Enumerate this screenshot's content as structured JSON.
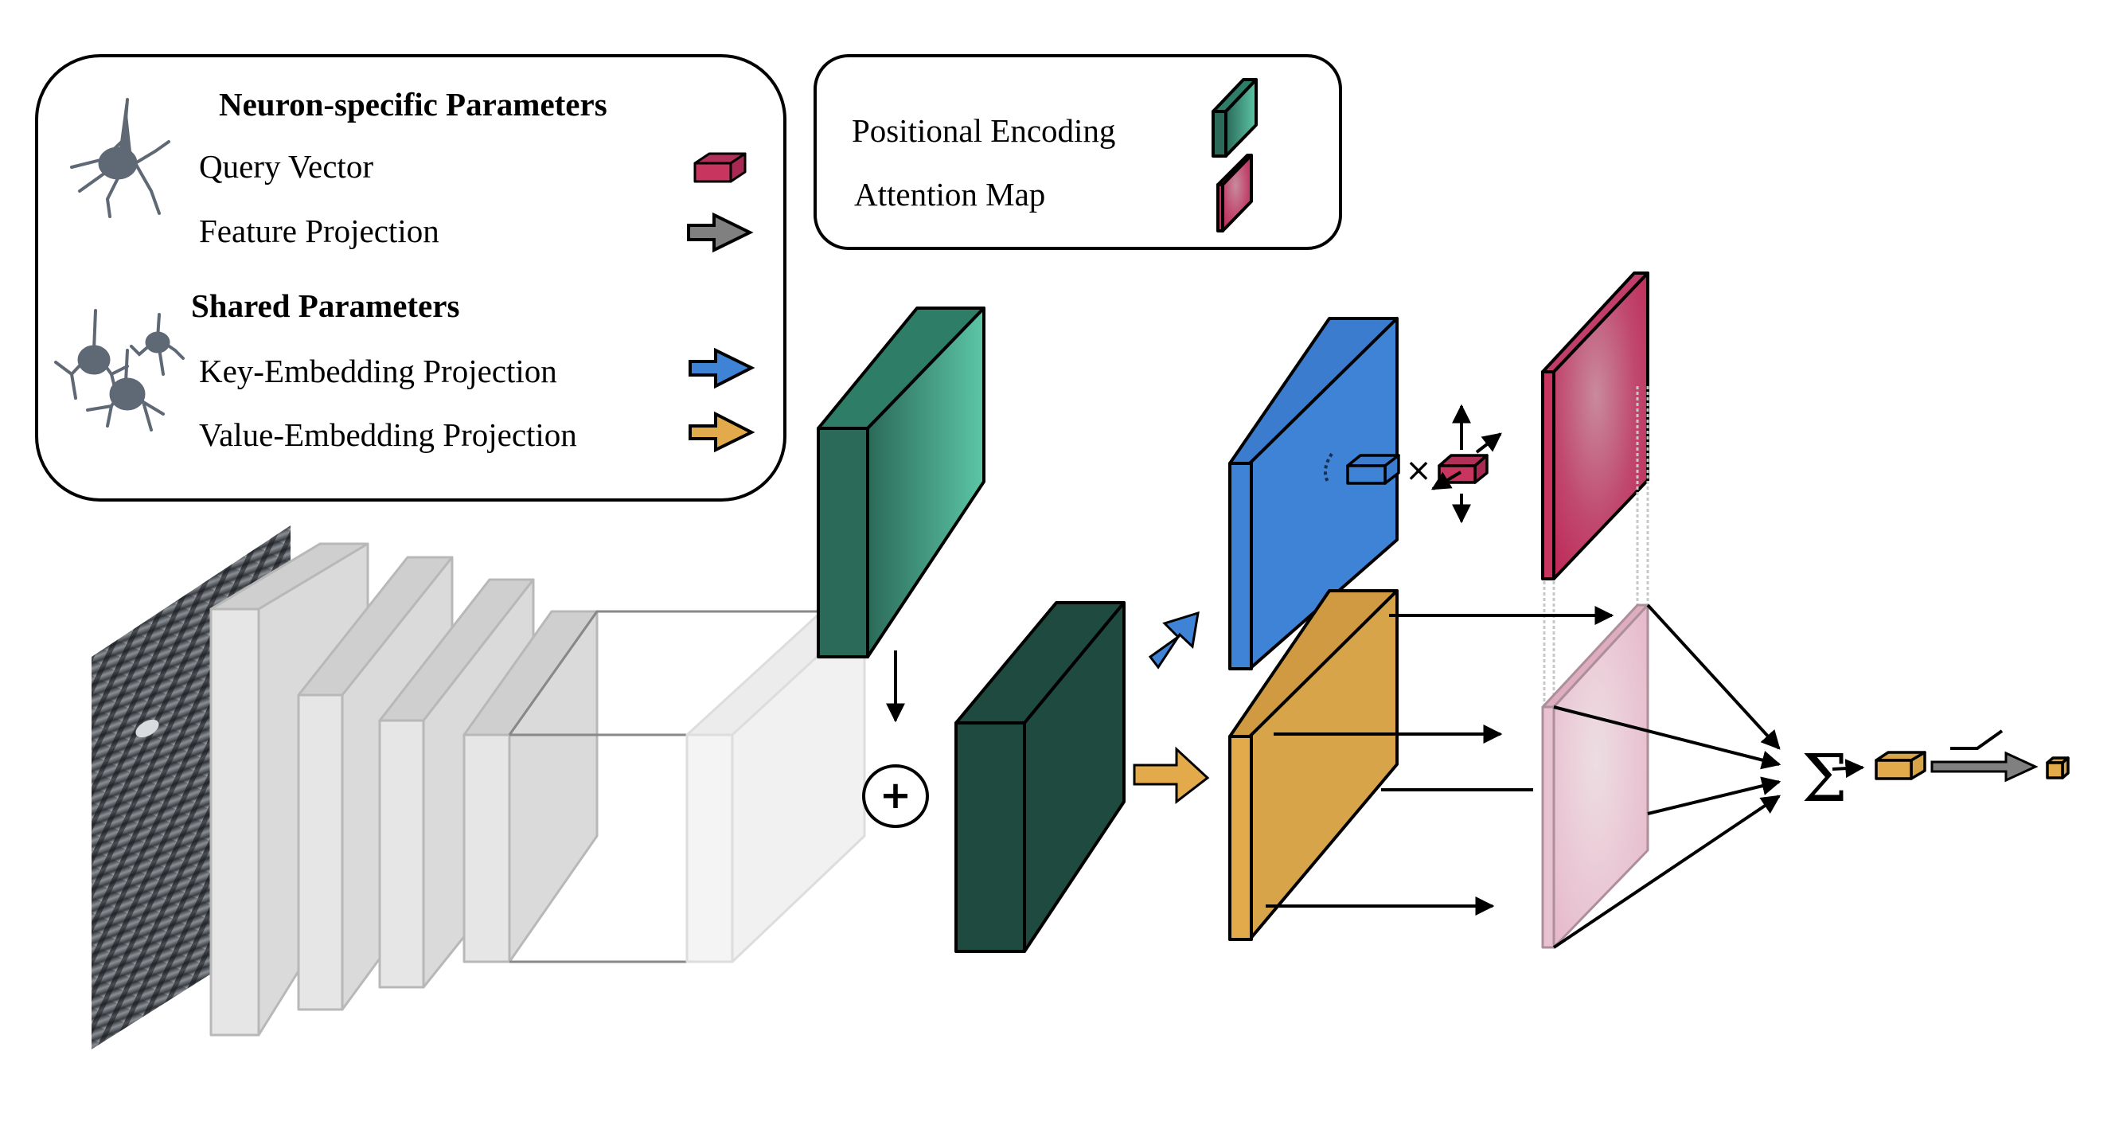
{
  "legend_main": {
    "neuron_specific_header": "Neuron-specific Parameters",
    "shared_header": "Shared Parameters",
    "items": [
      {
        "label": "Query Vector",
        "icon": "crimson-box-icon",
        "color": "#C8365F"
      },
      {
        "label": "Feature Projection",
        "icon": "gray-arrow-icon",
        "color": "#808080"
      },
      {
        "label": "Key-Embedding Projection",
        "icon": "blue-arrow-icon",
        "color": "#3F83D6"
      },
      {
        "label": "Value-Embedding Projection",
        "icon": "orange-arrow-icon",
        "color": "#E2AA4A"
      }
    ]
  },
  "legend_secondary": {
    "items": [
      {
        "label": "Positional Encoding",
        "icon": "teal-slab-icon",
        "color": "#2E7D66"
      },
      {
        "label": "Attention Map",
        "icon": "pink-slab-icon",
        "color": "#C23E6A"
      }
    ]
  },
  "diagram": {
    "plus_symbol": "+",
    "times_symbol": "×",
    "sum_symbol": "Σ",
    "colors": {
      "positional": "#2E7D66",
      "features": "#1E4A3F",
      "key": "#3F83D6",
      "value": "#D8A449",
      "attention": "#C23E6A",
      "attention_faded": "#E8BFD0",
      "cnn_layer": "#DCDCDC"
    }
  }
}
